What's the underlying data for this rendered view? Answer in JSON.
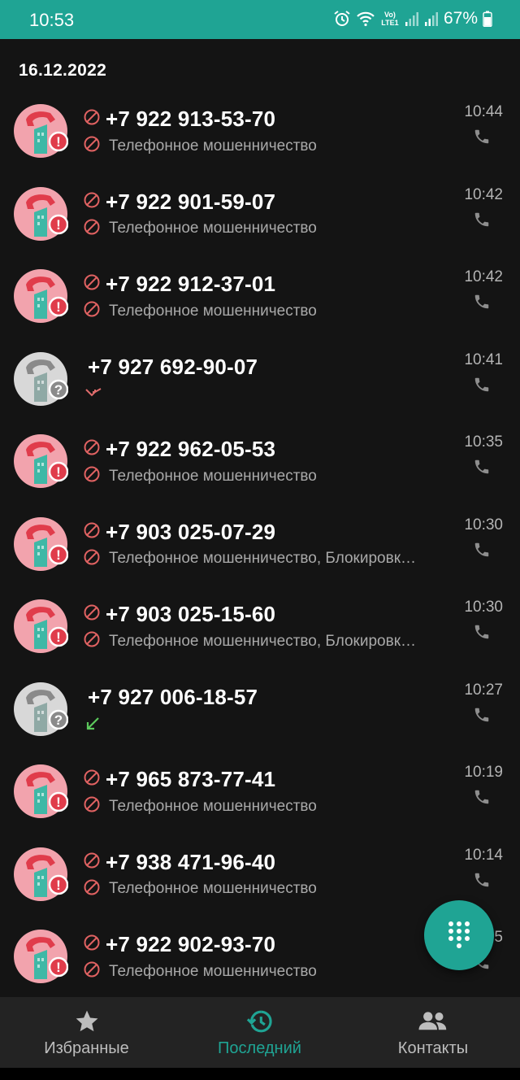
{
  "status_bar": {
    "time": "10:53",
    "battery": "67%",
    "network_label": "Vo) LTE1",
    "icons": [
      "alarm-icon",
      "wifi-icon",
      "signal-icon",
      "signal-icon",
      "battery-icon"
    ]
  },
  "date_header": "16.12.2022",
  "calls": [
    {
      "number": "+7 922 913-53-70",
      "label": "Телефонное мошенничество",
      "time": "10:44",
      "kind": "fraud"
    },
    {
      "number": "+7 922 901-59-07",
      "label": "Телефонное мошенничество",
      "time": "10:42",
      "kind": "fraud"
    },
    {
      "number": "+7 922 912-37-01",
      "label": "Телефонное мошенничество",
      "time": "10:42",
      "kind": "fraud"
    },
    {
      "number": "+7 927 692-90-07",
      "label": "",
      "time": "10:41",
      "kind": "unknown",
      "direction": "missed"
    },
    {
      "number": "+7 922 962-05-53",
      "label": "Телефонное мошенничество",
      "time": "10:35",
      "kind": "fraud"
    },
    {
      "number": "+7 903 025-07-29",
      "label": "Телефонное мошенничество, Блокировк…",
      "time": "10:30",
      "kind": "fraud"
    },
    {
      "number": "+7 903 025-15-60",
      "label": "Телефонное мошенничество, Блокировк…",
      "time": "10:30",
      "kind": "fraud"
    },
    {
      "number": "+7 927 006-18-57",
      "label": "",
      "time": "10:27",
      "kind": "unknown",
      "direction": "incoming"
    },
    {
      "number": "+7 965 873-77-41",
      "label": "Телефонное мошенничество",
      "time": "10:19",
      "kind": "fraud"
    },
    {
      "number": "+7 938 471-96-40",
      "label": "Телефонное мошенничество",
      "time": "10:14",
      "kind": "fraud"
    },
    {
      "number": "+7 922 902-93-70",
      "label": "Телефонное мошенничество",
      "time": "10:05",
      "kind": "fraud"
    }
  ],
  "fab": {
    "icon": "dialpad-icon"
  },
  "nav": [
    {
      "label": "Избранные",
      "icon": "star-icon",
      "active": false
    },
    {
      "label": "Последний",
      "icon": "history-icon",
      "active": true
    },
    {
      "label": "Контакты",
      "icon": "contacts-icon",
      "active": false
    }
  ],
  "colors": {
    "accent": "#1fa494",
    "fraud_avatar": "#f2a3ad",
    "fraud_red": "#e03c4b",
    "unknown_avatar": "#d8d8d8",
    "missed": "#e06c6c",
    "incoming": "#5cc85c"
  }
}
